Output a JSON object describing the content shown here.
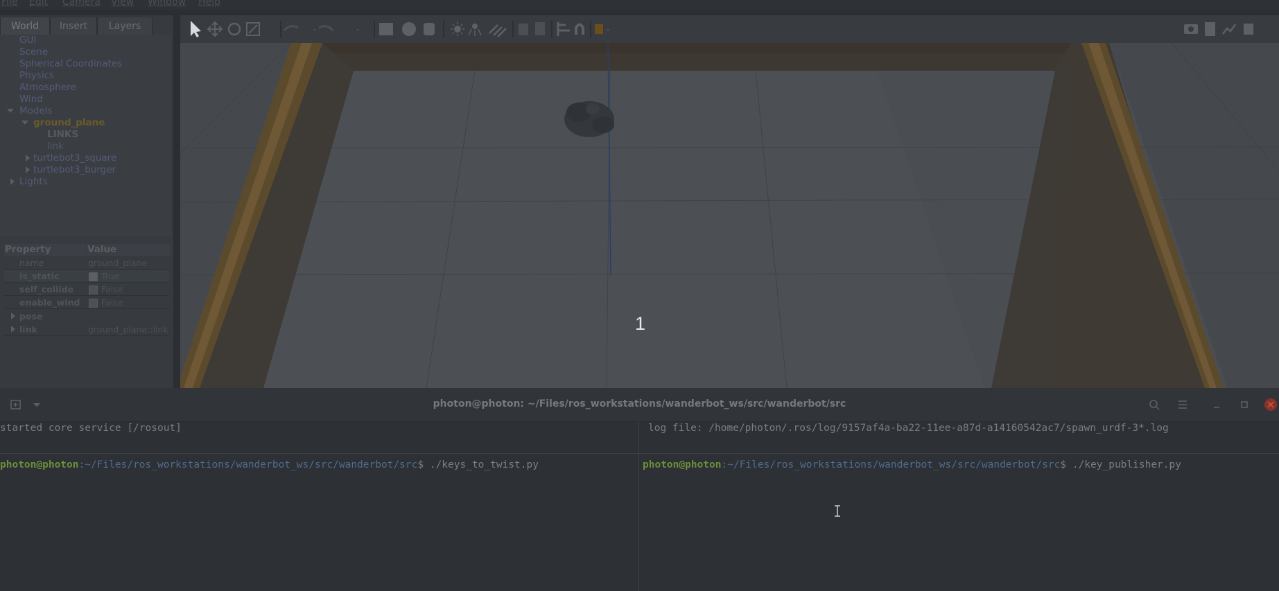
{
  "menu": [
    "File",
    "Edit",
    "Camera",
    "View",
    "Window",
    "Help"
  ],
  "tabs": [
    "World",
    "Insert",
    "Layers"
  ],
  "tree": {
    "items": [
      "GUI",
      "Scene",
      "Spherical Coordinates",
      "Physics",
      "Atmosphere",
      "Wind",
      "Models",
      "ground_plane",
      "LINKS",
      "link",
      "turtlebot3_square",
      "turtlebot3_burger",
      "Lights"
    ]
  },
  "props": {
    "headers": [
      "Property",
      "Value"
    ],
    "rows": [
      {
        "name": "name",
        "value": "ground_plane"
      },
      {
        "name": "is_static",
        "value": "True"
      },
      {
        "name": "self_collide",
        "value": "False"
      },
      {
        "name": "enable_wind",
        "value": "False"
      },
      {
        "name": "pose",
        "value": ""
      },
      {
        "name": "link",
        "value": "ground_plane::link"
      }
    ]
  },
  "viewport": {
    "number": "1"
  },
  "terminal": {
    "title": "photon@photon: ~/Files/ros_workstations/wanderbot_ws/src/wanderbot/src",
    "left_top": "started core service [/rosout]",
    "right_top": "log file: /home/photon/.ros/log/9157af4a-ba22-11ee-a87d-a14160542ac7/spawn_urdf-3*.log",
    "user": "photon@photon",
    "path": ":~/Files/ros_workstations/wanderbot_ws/src/wanderbot/src",
    "prompt_end": "$ ",
    "left_cmd": "./keys_to_twist.py",
    "right_cmd": "./key_publisher.py"
  },
  "colors": {
    "accent_green": "#6b8f3a",
    "path_blue": "#4f6c8e",
    "close_red": "#c0392b"
  }
}
